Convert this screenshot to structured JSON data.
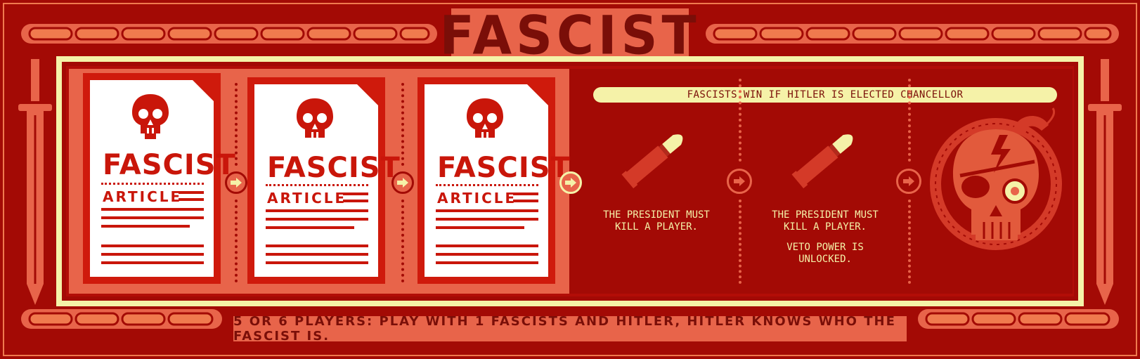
{
  "title": "FASCIST",
  "colors": {
    "background": "#a30a05",
    "plate": "#e8644a",
    "cream": "#f5f2a8",
    "dark": "#7a0e08",
    "card_red": "#cf1a0c"
  },
  "policy_slots": [
    {
      "title": "FASCIST",
      "subtitle": "ARTICLE",
      "icon": "skull-icon"
    },
    {
      "title": "FASCIST",
      "subtitle": "ARTICLE",
      "icon": "skull-icon"
    },
    {
      "title": "FASCIST",
      "subtitle": "ARTICLE",
      "icon": "skull-icon"
    }
  ],
  "banner_text": "FASCISTS WIN IF HITLER IS ELECTED CHANCELLOR",
  "power_slots": [
    {
      "icon": "bullet-icon",
      "line1": "THE PRESIDENT MUST",
      "line2": "KILL A PLAYER.",
      "extra1": "",
      "extra2": ""
    },
    {
      "icon": "bullet-icon",
      "line1": "THE PRESIDENT MUST",
      "line2": "KILL A PLAYER.",
      "extra1": "VETO POWER IS",
      "extra2": "UNLOCKED."
    }
  ],
  "final_icon": "skull-snake-icon",
  "footer_text": "5 OR 6 PLAYERS: PLAY WITH 1 FASCISTS AND HITLER, HITLER KNOWS WHO THE FASCIST IS."
}
